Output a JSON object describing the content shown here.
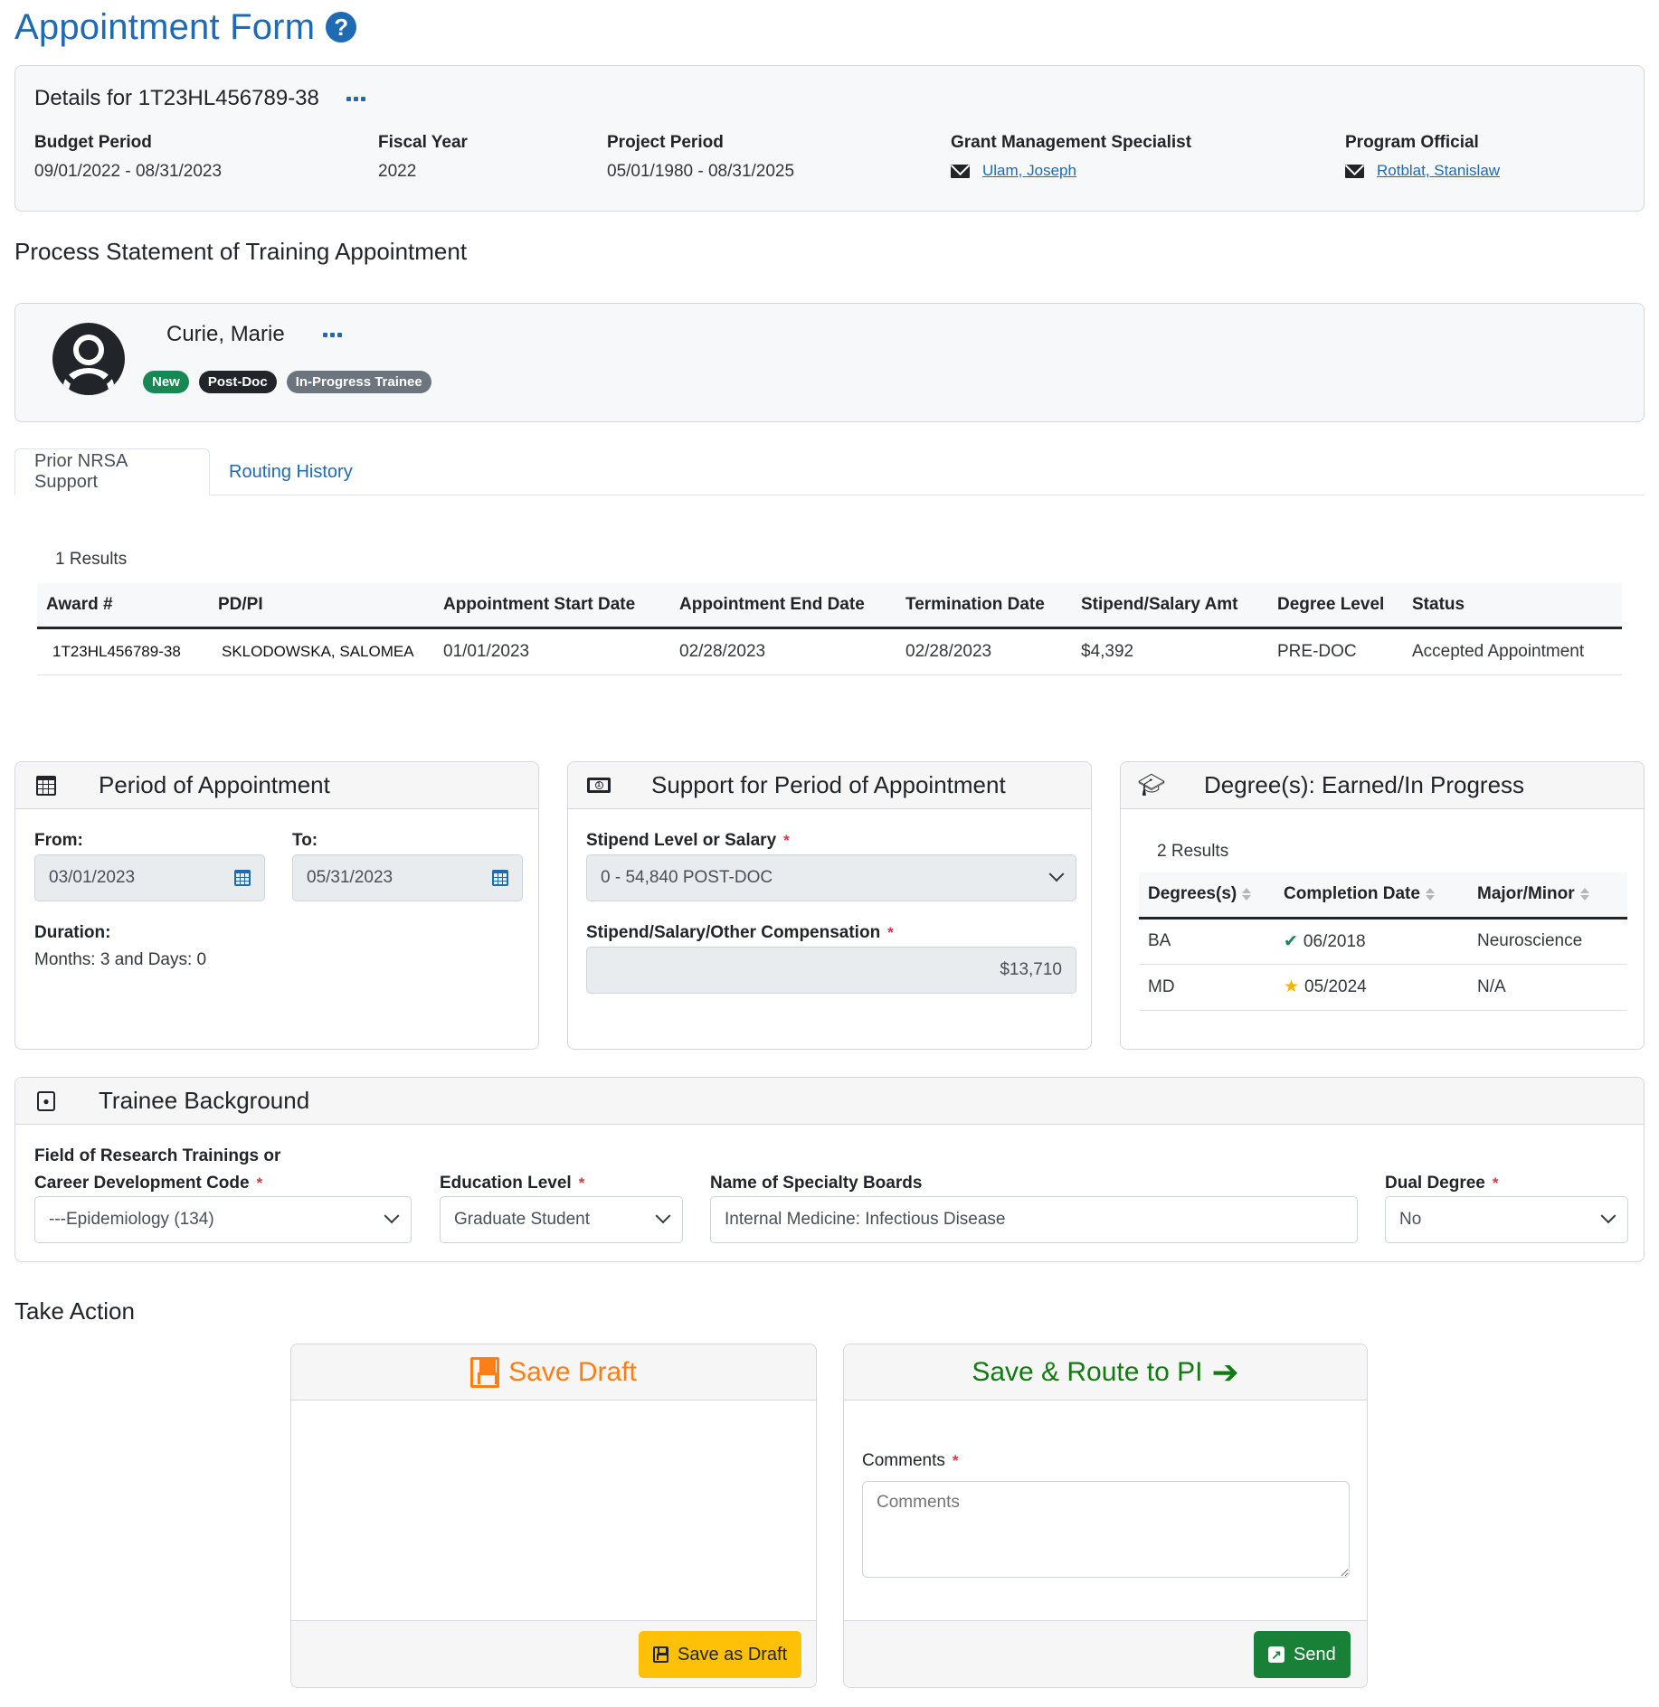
{
  "page": {
    "title": "Appointment Form",
    "help_icon": "question-circle-icon"
  },
  "details": {
    "title_prefix": "Details for",
    "grant_number": "1T23HL456789-38",
    "menu_icon": "ellipsis-icon",
    "budget_period": {
      "label": "Budget Period",
      "value": "09/01/2022 - 08/31/2023"
    },
    "fiscal_year": {
      "label": "Fiscal Year",
      "value": "2022"
    },
    "project_period": {
      "label": "Project Period",
      "value": "05/01/1980 - 08/31/2025"
    },
    "gms": {
      "label": "Grant Management Specialist",
      "name": "Ulam, Joseph",
      "icon": "envelope-icon"
    },
    "program_official": {
      "label": "Program Official",
      "name": "Rotblat, Stanislaw",
      "icon": "envelope-icon"
    }
  },
  "section_heading": "Process Statement of Training Appointment",
  "trainee": {
    "name": "Curie, Marie",
    "avatar_icon": "user-circle-icon",
    "badges": [
      {
        "label": "New",
        "color": "#198754"
      },
      {
        "label": "Post-Doc",
        "color": "#212529"
      },
      {
        "label": "In-Progress Trainee",
        "color": "#6c757d"
      }
    ]
  },
  "tabs": [
    {
      "label": "Prior NRSA Support",
      "active": true
    },
    {
      "label": "Routing History",
      "active": false
    }
  ],
  "nrsa": {
    "results": "1 Results",
    "columns": [
      "Award #",
      "PD/PI",
      "Appointment Start Date",
      "Appointment End Date",
      "Termination Date",
      "Stipend/Salary Amt",
      "Degree Level",
      "Status"
    ],
    "rows": [
      [
        "1T23HL456789-38",
        "SKLODOWSKA, SALOMEA",
        "01/01/2023",
        "02/28/2023",
        "02/28/2023",
        "$4,392",
        "PRE-DOC",
        "Accepted Appointment"
      ]
    ]
  },
  "period": {
    "title": "Period of Appointment",
    "icon": "calendar-icon",
    "from_label": "From:",
    "from_value": "03/01/2023",
    "to_label": "To:",
    "to_value": "05/31/2023",
    "duration_label": "Duration:",
    "duration_value": "Months: 3 and Days: 0"
  },
  "support": {
    "title": "Support for Period of Appointment",
    "icon": "money-bill-icon",
    "stipend_level_label": "Stipend Level or Salary",
    "stipend_level_value": "0 - 54,840 POST-DOC",
    "compensation_label": "Stipend/Salary/Other Compensation",
    "compensation_value": "$13,710",
    "required_mark": "*"
  },
  "degrees": {
    "title": "Degree(s): Earned/In Progress",
    "icon": "graduation-cap-icon",
    "results": "2 Results",
    "columns": [
      "Degrees(s)",
      "Completion Date",
      "Major/Minor"
    ],
    "rows": [
      {
        "degree": "BA",
        "status_icon": "check-icon",
        "date": "06/2018",
        "major": "Neuroscience"
      },
      {
        "degree": "MD",
        "status_icon": "star-half-icon",
        "date": "05/2024",
        "major": "N/A"
      }
    ]
  },
  "background": {
    "title": "Trainee Background",
    "icon": "address-book-icon",
    "field_label_line1": "Field of Research Trainings or",
    "field_label_line2": "Career Development Code",
    "field_value": "---Epidemiology (134)",
    "education_label": "Education Level",
    "education_value": "Graduate Student",
    "specialty_label": "Name of Specialty Boards",
    "specialty_value": "Internal Medicine: Infectious Disease",
    "dual_label": "Dual Degree",
    "dual_value": "No"
  },
  "take_action": {
    "heading": "Take Action",
    "save_draft": {
      "title": "Save Draft",
      "color": "#fd7e14",
      "button": "Save as Draft",
      "button_color": "#ffc107"
    },
    "route": {
      "title": "Save & Route to PI",
      "color": "#137a13",
      "comments_label": "Comments",
      "comments_placeholder": "Comments",
      "comments_value": "",
      "button": "Send",
      "button_color": "#198038"
    }
  }
}
